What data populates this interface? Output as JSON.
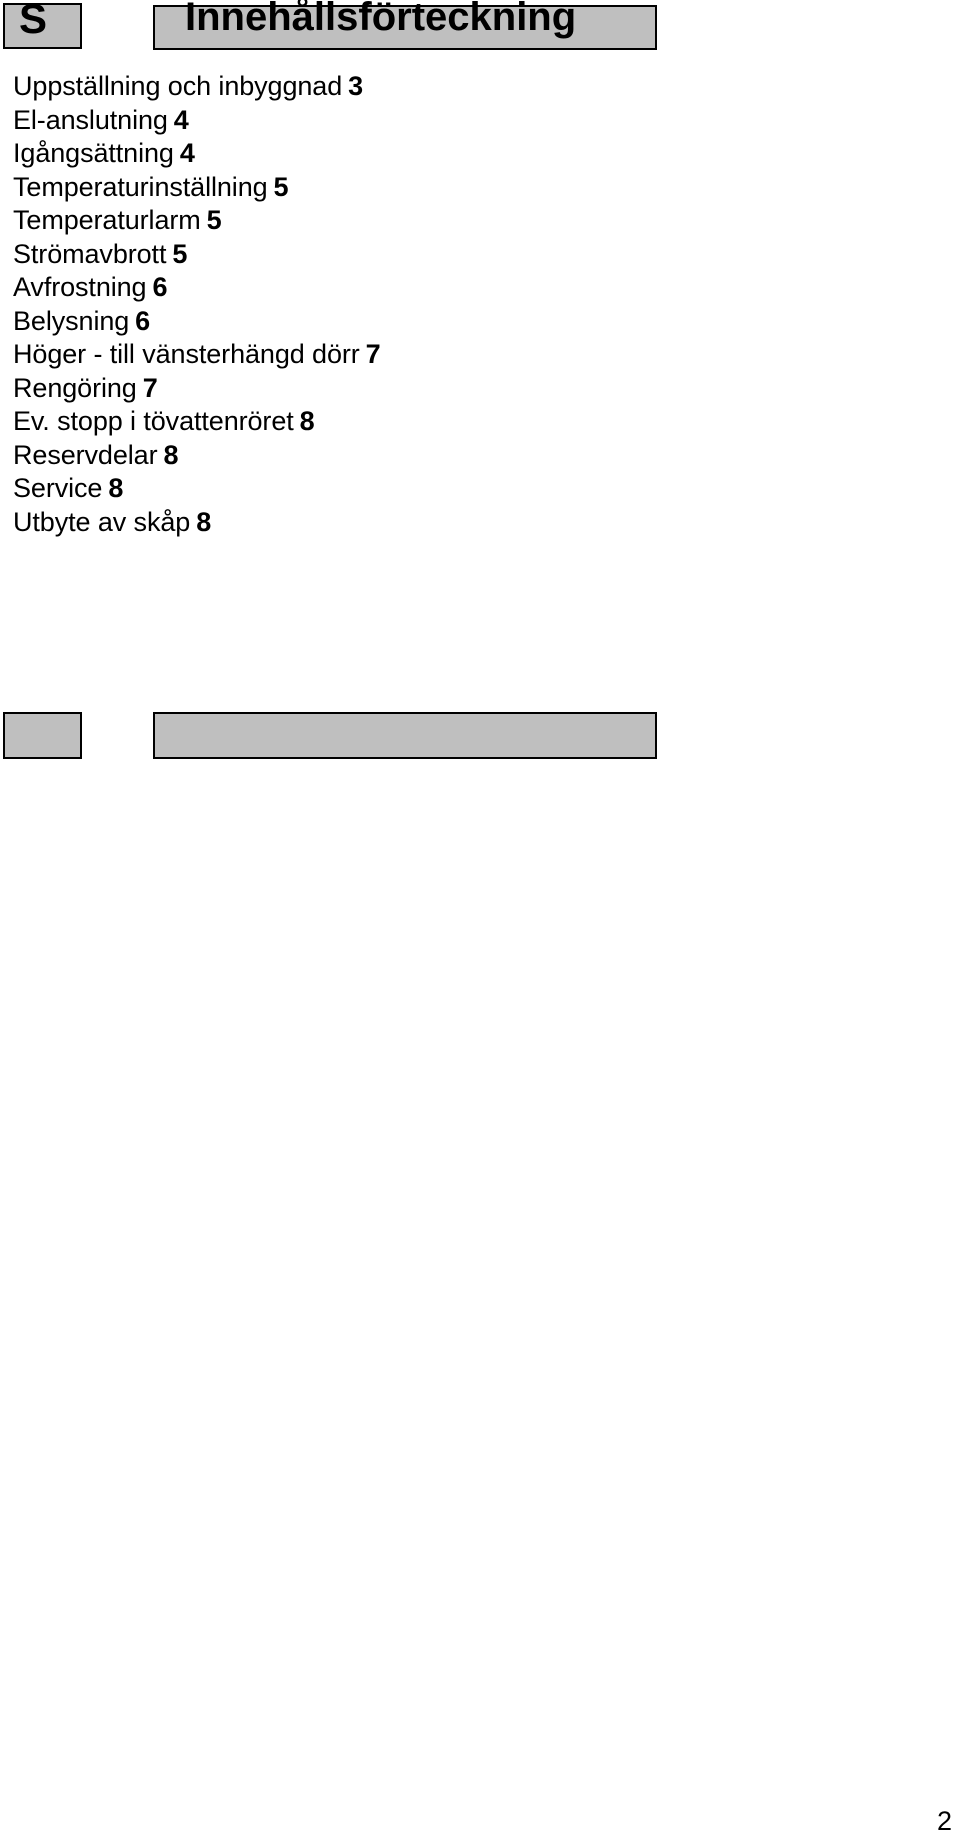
{
  "header": {
    "language_code": "S",
    "title": "Innehållsförteckning"
  },
  "toc": {
    "entries": [
      {
        "title": "Uppställning och inbyggnad",
        "page": "3"
      },
      {
        "title": "El-anslutning",
        "page": "4"
      },
      {
        "title": "Igångsättning",
        "page": "4"
      },
      {
        "title": "Temperaturinställning",
        "page": "5"
      },
      {
        "title": "Temperaturlarm",
        "page": "5"
      },
      {
        "title": "Strömavbrott",
        "page": "5"
      },
      {
        "title": "Avfrostning",
        "page": "6"
      },
      {
        "title": "Belysning",
        "page": "6"
      },
      {
        "title": "Höger - till vänsterhängd dörr",
        "page": "7"
      },
      {
        "title": "Rengöring",
        "page": "7"
      },
      {
        "title": "Ev. stopp i tövattenröret",
        "page": "8"
      },
      {
        "title": "Reservdelar",
        "page": "8"
      },
      {
        "title": "Service",
        "page": "8"
      },
      {
        "title": "Utbyte av skåp",
        "page": "8"
      }
    ]
  },
  "footer": {
    "box_small_text": "",
    "box_wide_text": ""
  },
  "page_number": "2",
  "colors": {
    "box_fill": "#bfbfbf",
    "box_border": "#000000",
    "text": "#000000",
    "background": "#ffffff"
  }
}
